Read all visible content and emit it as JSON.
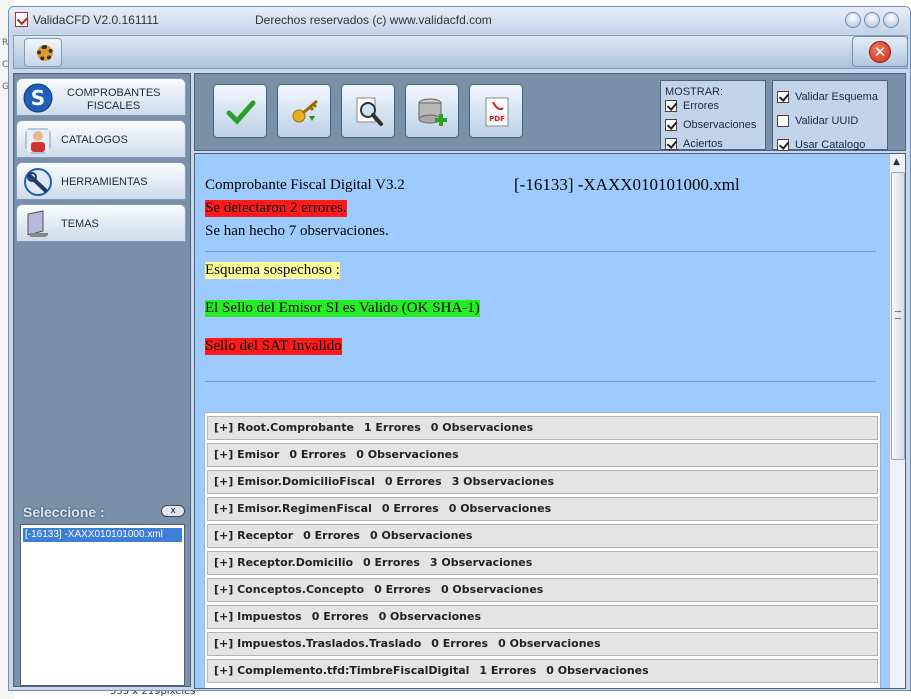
{
  "background": {
    "strip_letters": [
      "R",
      "C",
      "G"
    ],
    "bottom_text": "553 x 219pixeles"
  },
  "window": {
    "title": "ValidaCFD V2.0.161111",
    "rights": "Derechos reservados (c) www.validacfd.com"
  },
  "toolbar_top": {
    "settings_icon": "gear-icon",
    "close_icon": "close-icon"
  },
  "sidebar": {
    "items": [
      {
        "line1": "COMPROBANTES",
        "line2": "FISCALES",
        "icon": "dollar-icon"
      },
      {
        "line1": "CATALOGOS",
        "line2": "",
        "icon": "person-icon"
      },
      {
        "line1": "HERRAMIENTAS",
        "line2": "",
        "icon": "tools-icon"
      },
      {
        "line1": "TEMAS",
        "line2": "",
        "icon": "monitor-icon"
      }
    ],
    "seleccione_label": "Seleccione :",
    "seleccione_close": "x",
    "list_items": [
      "[-16133] -XAXX010101000.xml"
    ]
  },
  "main_toolbar": {
    "buttons": [
      {
        "icon": "check-icon"
      },
      {
        "icon": "key-icon"
      },
      {
        "icon": "magnifier-icon"
      },
      {
        "icon": "database-add-icon"
      },
      {
        "icon": "pdf-icon"
      }
    ],
    "mostrar": {
      "title": "MOSTRAR:",
      "options": [
        {
          "label": "Errores",
          "checked": true
        },
        {
          "label": "Observaciones",
          "checked": true
        },
        {
          "label": "Aciertos",
          "checked": true
        }
      ]
    },
    "validar": {
      "options": [
        {
          "label": "Validar Esquema",
          "checked": true
        },
        {
          "label": "Validar UUID",
          "checked": false
        },
        {
          "label": "Usar Catalogo",
          "checked": true
        }
      ]
    }
  },
  "content": {
    "doc_type": "Comprobante Fiscal Digital V3.2",
    "file_name": "[-16133] -XAXX010101000.xml",
    "errors_msg": "Se detectaron 2 errores.",
    "obs_msg": "Se han hecho 7 observaciones.",
    "schema_msg": "Esquema sospechoso :",
    "emisor_seal_msg": "El Sello del Emisor SI es Valido (OK SHA-1)",
    "sat_seal_msg": "Sello del SAT Invalido",
    "nodes": [
      {
        "name": "[+] Root.Comprobante",
        "errors": "1 Errores",
        "obs": "0 Observaciones"
      },
      {
        "name": "[+] Emisor",
        "errors": "0 Errores",
        "obs": "0 Observaciones"
      },
      {
        "name": "[+] Emisor.DomicilioFiscal",
        "errors": "0 Errores",
        "obs": "3 Observaciones"
      },
      {
        "name": "[+] Emisor.RegimenFiscal",
        "errors": "0 Errores",
        "obs": "0 Observaciones"
      },
      {
        "name": "[+] Receptor",
        "errors": "0 Errores",
        "obs": "0 Observaciones"
      },
      {
        "name": "[+] Receptor.Domicilio",
        "errors": "0 Errores",
        "obs": "3 Observaciones"
      },
      {
        "name": "[+] Conceptos.Concepto",
        "errors": "0 Errores",
        "obs": "0 Observaciones"
      },
      {
        "name": "[+] Impuestos",
        "errors": "0 Errores",
        "obs": "0 Observaciones"
      },
      {
        "name": "[+] Impuestos.Traslados.Traslado",
        "errors": "0 Errores",
        "obs": "0 Observaciones"
      },
      {
        "name": "[+] Complemento.tfd:TimbreFiscalDigital",
        "errors": "1 Errores",
        "obs": "0 Observaciones"
      }
    ]
  }
}
